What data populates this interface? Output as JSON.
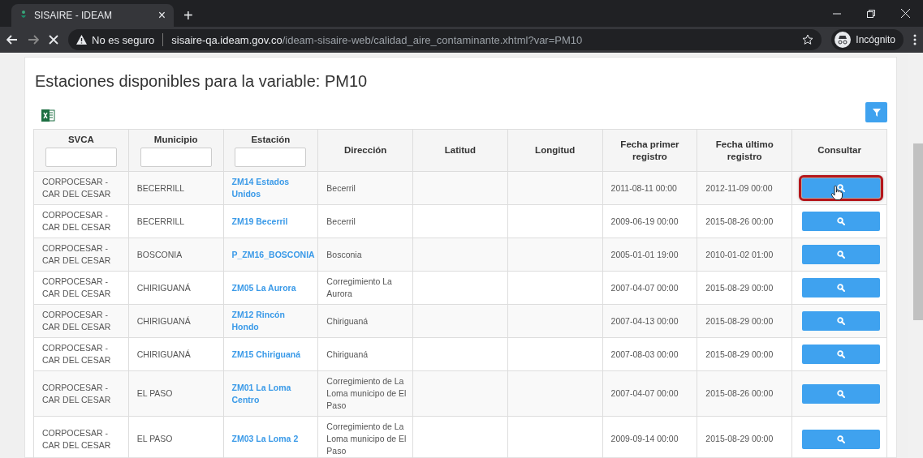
{
  "browser": {
    "tab_title": "SISAIRE - IDEAM",
    "tab_close": "×",
    "new_tab": "+",
    "security": "No es seguro",
    "url_host": "sisaire-qa.ideam.gov.co",
    "url_path": "/ideam-sisaire-web/calidad_aire_contaminante.xhtml?var=PM10",
    "profile": "Incógnito",
    "loading": true
  },
  "page": {
    "title": "Estaciones disponibles para la variable: PM10",
    "table": {
      "columns": [
        {
          "label": "SVCA",
          "kind": "filter"
        },
        {
          "label": "Municipio",
          "kind": "filter"
        },
        {
          "label": "Estación",
          "kind": "filter"
        },
        {
          "label": "Dirección",
          "kind": "plain"
        },
        {
          "label": "Latitud",
          "kind": "plain"
        },
        {
          "label": "Longitud",
          "kind": "plain"
        },
        {
          "label": "Fecha primer registro",
          "kind": "plain"
        },
        {
          "label": "Fecha último registro",
          "kind": "plain"
        },
        {
          "label": "Consultar",
          "kind": "plain"
        }
      ],
      "rows": [
        {
          "svca": "CORPOCESAR - CAR DEL CESAR",
          "municipio": "BECERRILL",
          "estacion": "ZM14 Estados Unidos",
          "direccion": "Becerril",
          "fecha_primer": "2011-08-11 00:00",
          "fecha_ultimo": "2012-11-09 00:00",
          "highlighted": true
        },
        {
          "svca": "CORPOCESAR - CAR DEL CESAR",
          "municipio": "BECERRILL",
          "estacion": "ZM19 Becerril",
          "direccion": "Becerril",
          "fecha_primer": "2009-06-19 00:00",
          "fecha_ultimo": "2015-08-26 00:00",
          "highlighted": false
        },
        {
          "svca": "CORPOCESAR - CAR DEL CESAR",
          "municipio": "BOSCONIA",
          "estacion": "P_ZM16_BOSCONIA",
          "direccion": "Bosconia",
          "fecha_primer": "2005-01-01 19:00",
          "fecha_ultimo": "2010-01-02 01:00",
          "highlighted": false
        },
        {
          "svca": "CORPOCESAR - CAR DEL CESAR",
          "municipio": "CHIRIGUANÁ",
          "estacion": "ZM05 La Aurora",
          "direccion": "Corregimiento La Aurora",
          "fecha_primer": "2007-04-07 00:00",
          "fecha_ultimo": "2015-08-29 00:00",
          "highlighted": false
        },
        {
          "svca": "CORPOCESAR - CAR DEL CESAR",
          "municipio": "CHIRIGUANÁ",
          "estacion": "ZM12 Rincón Hondo",
          "direccion": "Chiriguaná",
          "fecha_primer": "2007-04-13 00:00",
          "fecha_ultimo": "2015-08-29 00:00",
          "highlighted": false
        },
        {
          "svca": "CORPOCESAR - CAR DEL CESAR",
          "municipio": "CHIRIGUANÁ",
          "estacion": "ZM15 Chiriguaná",
          "direccion": "Chiriguaná",
          "fecha_primer": "2007-08-03 00:00",
          "fecha_ultimo": "2015-08-29 00:00",
          "highlighted": false
        },
        {
          "svca": "CORPOCESAR - CAR DEL CESAR",
          "municipio": "EL PASO",
          "estacion": "ZM01 La Loma Centro",
          "direccion": "Corregimiento de La Loma municipo de El Paso",
          "fecha_primer": "2007-04-07 00:00",
          "fecha_ultimo": "2015-08-26 00:00",
          "highlighted": false
        },
        {
          "svca": "CORPOCESAR - CAR DEL CESAR",
          "municipio": "EL PASO",
          "estacion": "ZM03 La Loma 2",
          "direccion": "Corregimiento de La Loma municipo de El Paso",
          "fecha_primer": "2009-09-14 00:00",
          "fecha_ultimo": "2015-08-29 00:00",
          "highlighted": false
        }
      ]
    }
  }
}
